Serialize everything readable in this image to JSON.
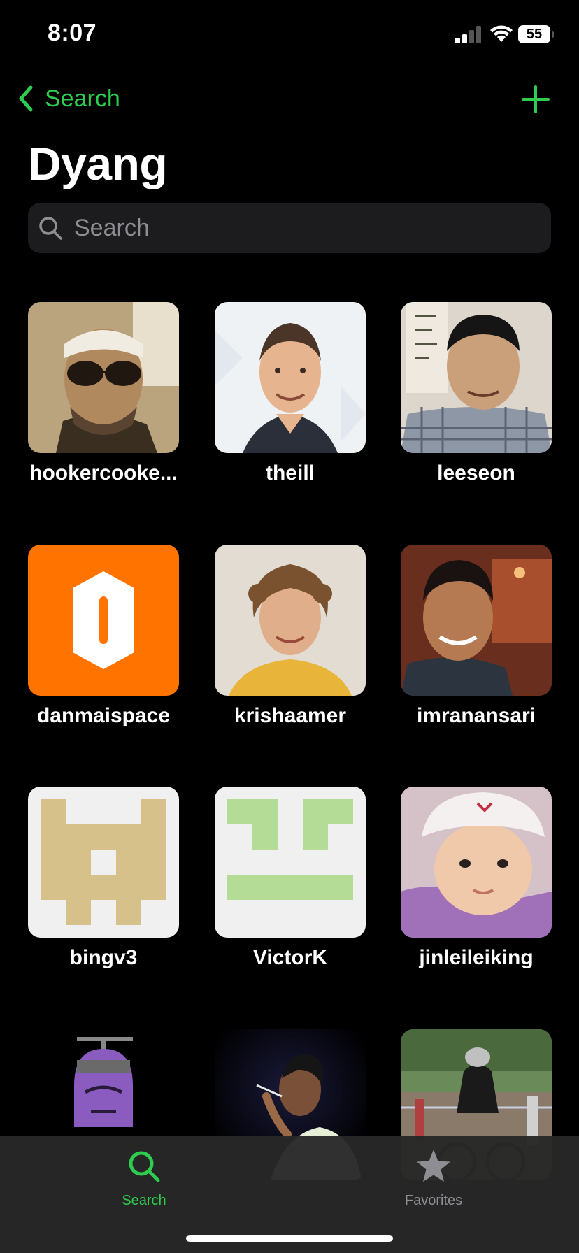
{
  "status": {
    "time": "8:07",
    "battery": "55"
  },
  "nav": {
    "back_label": "Search"
  },
  "title": "Dyang",
  "search": {
    "placeholder": "Search"
  },
  "users": [
    {
      "name": "hookercooke..."
    },
    {
      "name": "theill"
    },
    {
      "name": "leeseon"
    },
    {
      "name": "danmaispace"
    },
    {
      "name": "krishaamer"
    },
    {
      "name": "imranansari"
    },
    {
      "name": "bingv3"
    },
    {
      "name": "VictorK"
    },
    {
      "name": "jinleileiking"
    },
    {
      "name": ""
    },
    {
      "name": ""
    },
    {
      "name": ""
    }
  ],
  "tabs": [
    {
      "label": "Search",
      "icon": "search-icon",
      "active": true
    },
    {
      "label": "Favorites",
      "icon": "star-icon",
      "active": false
    }
  ],
  "colors": {
    "accent": "#2ecc4f",
    "inactive": "#8e8e93",
    "background": "#000000"
  }
}
